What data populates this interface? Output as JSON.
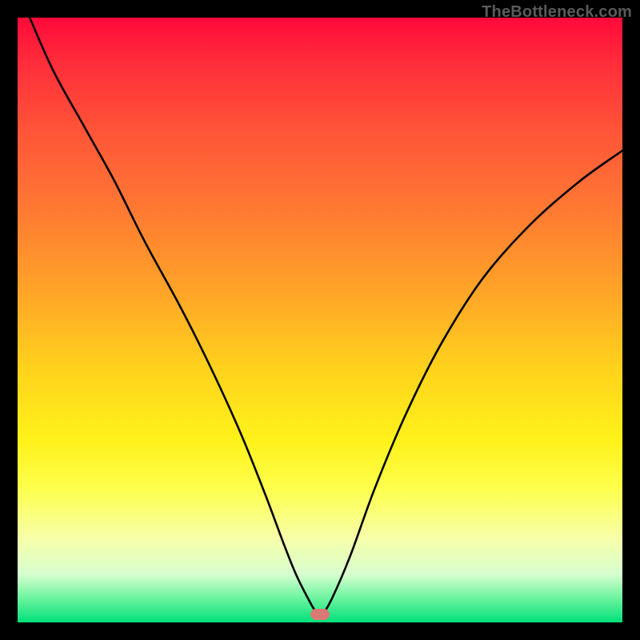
{
  "watermark": "TheBottleneck.com",
  "axes": {
    "x_range": [
      0,
      100
    ],
    "y_range": [
      0,
      100
    ],
    "grid": false
  },
  "chart_data": {
    "type": "line",
    "title": "",
    "xlabel": "",
    "ylabel": "",
    "xlim": [
      0,
      100
    ],
    "ylim": [
      0,
      100
    ],
    "series": [
      {
        "name": "curve",
        "x": [
          2,
          6,
          11,
          16,
          21,
          27,
          32,
          37,
          41,
          44,
          46,
          48,
          49.5,
          50.5,
          52,
          55,
          59,
          64,
          70,
          77,
          85,
          93,
          100
        ],
        "y": [
          100,
          91,
          82,
          73,
          63,
          52,
          42,
          31,
          21,
          13,
          8,
          4,
          1.5,
          1.5,
          4,
          11,
          22,
          34,
          46,
          57,
          66,
          73,
          78
        ]
      }
    ],
    "marker": {
      "x": 50,
      "y": 1.3,
      "shape": "rounded-rect",
      "color": "#d87a74"
    }
  },
  "colors": {
    "gradient_top": "#ff0a3a",
    "gradient_bottom": "#00e07a",
    "curve": "#000000",
    "background": "#000000"
  }
}
